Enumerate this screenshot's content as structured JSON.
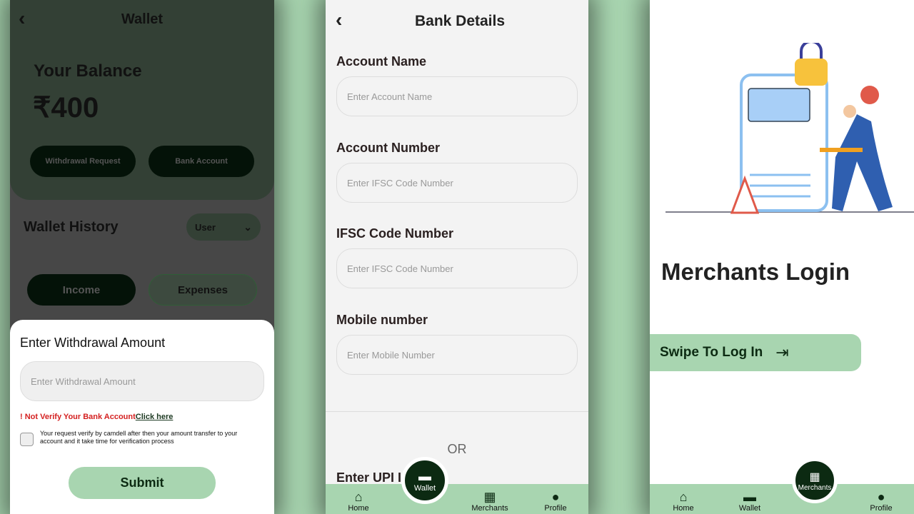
{
  "wallet": {
    "title": "Wallet",
    "balance_label": "Your Balance",
    "balance": "₹400",
    "withdrawal_button": "Withdrawal Request",
    "bank_button": "Bank Account",
    "history_title": "Wallet History",
    "filter_value": "User",
    "tabs": [
      "Income",
      "Expenses"
    ]
  },
  "withdraw_sheet": {
    "title": "Enter Withdrawal Amount",
    "amount_placeholder": "Enter Withdrawal Amount",
    "warning": "! Not Verify Your Bank Account",
    "click_here": "Click here",
    "note": "Your request verify by camdell after then your amount transfer to your account and it take time for verification process",
    "submit": "Submit",
    "checkbox_checked": false
  },
  "bank": {
    "title": "Bank Details",
    "fields": [
      {
        "label": "Account Name",
        "placeholder": "Enter Account Name"
      },
      {
        "label": "Account Number",
        "placeholder": "Enter IFSC Code Number"
      },
      {
        "label": "IFSC Code Number",
        "placeholder": "Enter IFSC Code Number"
      },
      {
        "label": "Mobile number",
        "placeholder": "Enter Mobile Number"
      }
    ],
    "or": "OR",
    "upi_label": "Enter UPI I"
  },
  "nav1": {
    "home": "Home",
    "wallet": "Wallet",
    "merchants": "Merchants",
    "profile": "Profile",
    "active": "Wallet"
  },
  "merchant": {
    "title": "Merchants Login",
    "swipe": "Swipe To Log In"
  },
  "nav2": {
    "home": "Home",
    "wallet": "Wallet",
    "merchants": "Merchants",
    "profile": "Profile",
    "active": "Merchants"
  },
  "colors": {
    "accent": "#a8d5b0",
    "dark": "#0c2a12",
    "warning": "#d42020"
  }
}
